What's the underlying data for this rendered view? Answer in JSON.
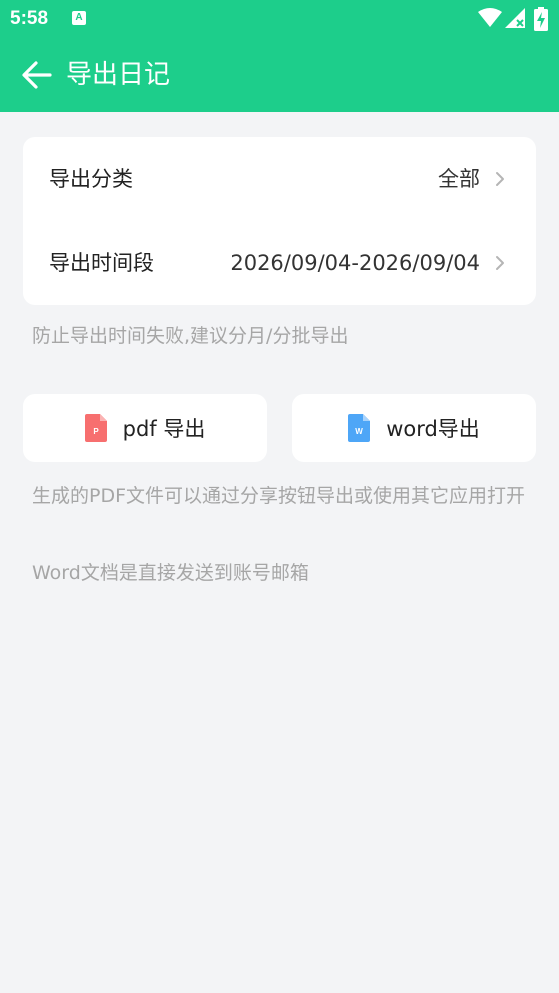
{
  "status_bar": {
    "time": "5:58",
    "notification_icon_letter": "A",
    "icons": [
      "a-notification-icon",
      "wifi-icon",
      "signal-icon",
      "battery-icon"
    ]
  },
  "app_bar": {
    "title": "导出日记",
    "back_icon": "arrow-left-icon"
  },
  "settings": {
    "category": {
      "label": "导出分类",
      "value": "全部"
    },
    "time_range": {
      "label": "导出时间段",
      "value": "2026/09/04-2026/09/04"
    }
  },
  "hints": {
    "time_hint": "防止导出时间失败,建议分月/分批导出",
    "pdf_hint": "生成的PDF文件可以通过分享按钮导出或使用其它应用打开",
    "word_hint": "Word文档是直接发送到账号邮箱"
  },
  "export_buttons": {
    "pdf": {
      "label": "pdf 导出",
      "icon_letter": "P",
      "icon_color": "#f76f6f"
    },
    "word": {
      "label": "word导出",
      "icon_letter": "W",
      "icon_color": "#4ea6f7"
    }
  },
  "colors": {
    "accent": "#1dce8b",
    "background": "#f3f4f6",
    "hint": "#a6a6a6"
  }
}
